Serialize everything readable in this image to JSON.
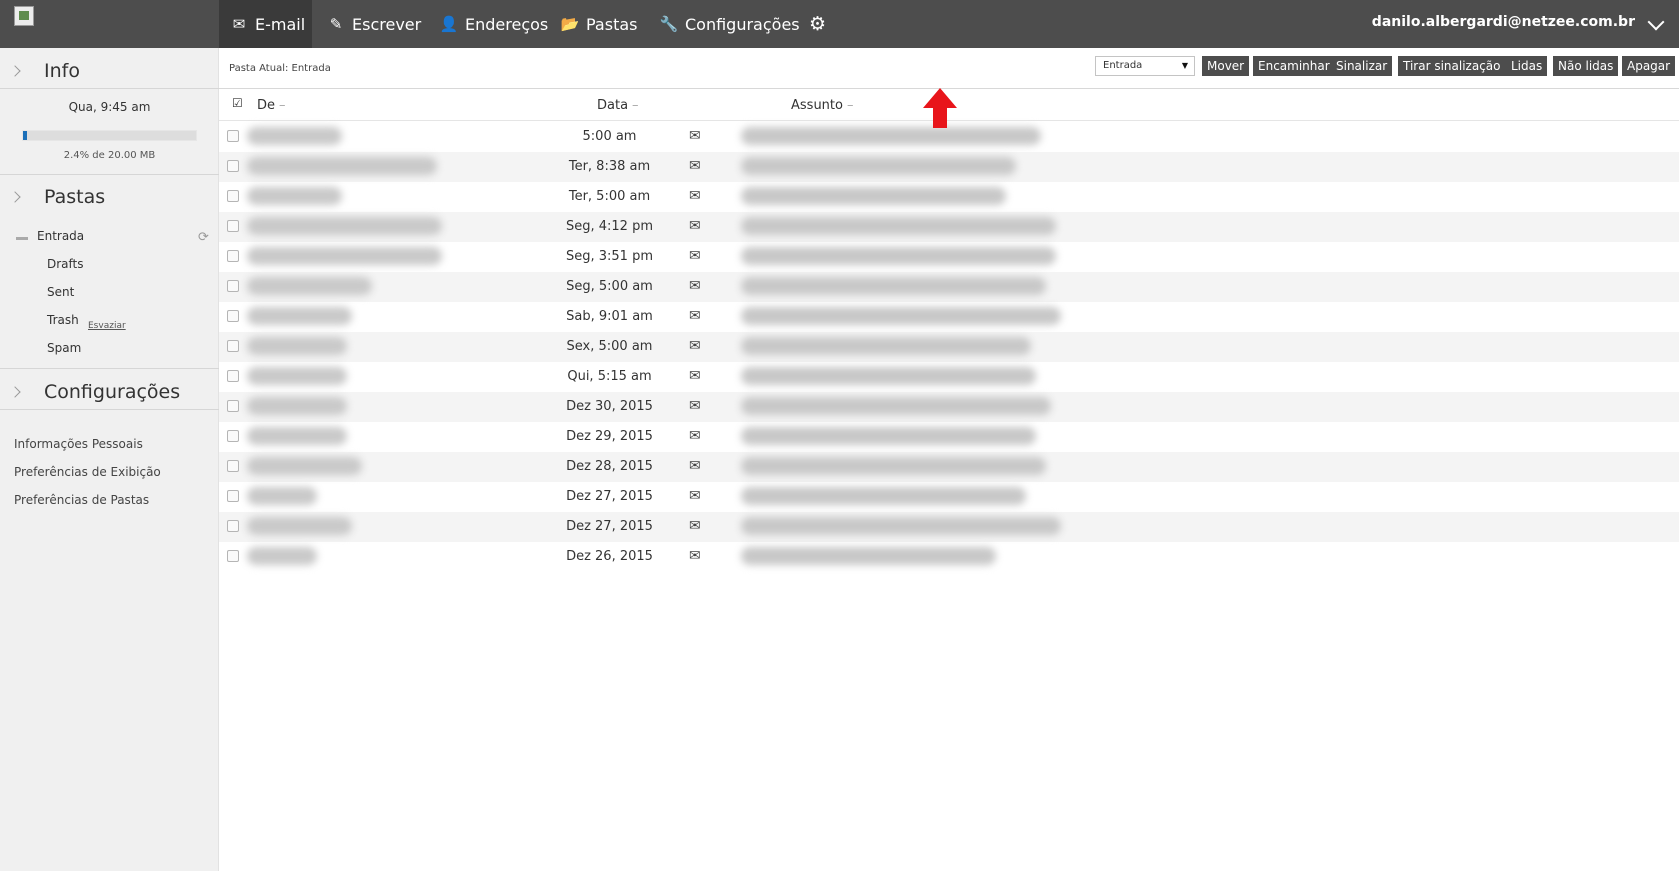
{
  "nav": {
    "email": "E-mail",
    "compose": "Escrever",
    "addresses": "Endereços",
    "folders": "Pastas",
    "settings": "Configurações"
  },
  "user": {
    "email": "danilo.albergardi@netzee.com.br"
  },
  "sidebar": {
    "info_title": "Info",
    "date": "Qua, 9:45 am",
    "quota_percent": 2.4,
    "quota_text": "2.4% de 20.00 MB",
    "folders_title": "Pastas",
    "folders": [
      "Entrada",
      "Drafts",
      "Sent",
      "Trash",
      "Spam"
    ],
    "empty_trash": "Esvaziar",
    "settings_title": "Configurações",
    "settings_links": [
      "Informações Pessoais",
      "Preferências de Exibição",
      "Preferências de Pastas"
    ]
  },
  "toolbar": {
    "current_folder": "Pasta Atual: Entrada",
    "move_target": "Entrada",
    "buttons": [
      "Mover",
      "Encaminhar",
      "Sinalizar",
      "Tirar sinalização",
      "Lidas",
      "Não lidas",
      "Apagar"
    ]
  },
  "columns": {
    "from": "De",
    "date": "Data",
    "subject": "Assunto"
  },
  "messages": [
    {
      "date": "5:00 am"
    },
    {
      "date": "Ter, 8:38 am"
    },
    {
      "date": "Ter, 5:00 am"
    },
    {
      "date": "Seg, 4:12 pm"
    },
    {
      "date": "Seg, 3:51 pm"
    },
    {
      "date": "Seg, 5:00 am"
    },
    {
      "date": "Sab, 9:01 am"
    },
    {
      "date": "Sex, 5:00 am"
    },
    {
      "date": "Qui, 5:15 am"
    },
    {
      "date": "Dez 30, 2015"
    },
    {
      "date": "Dez 29, 2015"
    },
    {
      "date": "Dez 28, 2015"
    },
    {
      "date": "Dez 27, 2015"
    },
    {
      "date": "Dez 27, 2015"
    },
    {
      "date": "Dez 26, 2015"
    }
  ],
  "colors": {
    "topbar": "#4d4d4d",
    "quota": "#1b6fb8",
    "arrow": "#e8151b"
  }
}
